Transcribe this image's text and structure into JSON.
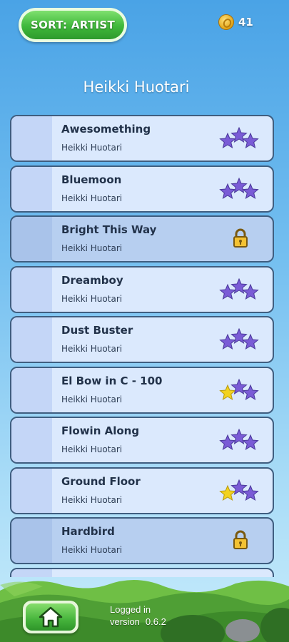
{
  "header": {
    "sort_label": "SORT: ARTIST",
    "coin_count": "41",
    "coin_icon": "coin-icon"
  },
  "page_title": "Heikki Huotari",
  "songs": [
    {
      "title": "Awesomething",
      "artist": "Heikki Huotari",
      "state": "stars",
      "gold_stars": 0,
      "purple_stars": 3
    },
    {
      "title": "Bluemoon",
      "artist": "Heikki Huotari",
      "state": "stars",
      "gold_stars": 0,
      "purple_stars": 3
    },
    {
      "title": "Bright This Way",
      "artist": "Heikki Huotari",
      "state": "locked"
    },
    {
      "title": "Dreamboy",
      "artist": "Heikki Huotari",
      "state": "stars",
      "gold_stars": 0,
      "purple_stars": 3
    },
    {
      "title": "Dust Buster",
      "artist": "Heikki Huotari",
      "state": "stars",
      "gold_stars": 0,
      "purple_stars": 3
    },
    {
      "title": "El Bow in C - 100",
      "artist": "Heikki Huotari",
      "state": "stars",
      "gold_stars": 1,
      "purple_stars": 2
    },
    {
      "title": "Flowin Along",
      "artist": "Heikki Huotari",
      "state": "stars",
      "gold_stars": 0,
      "purple_stars": 3
    },
    {
      "title": "Ground Floor",
      "artist": "Heikki Huotari",
      "state": "stars",
      "gold_stars": 1,
      "purple_stars": 2
    },
    {
      "title": "Hardbird",
      "artist": "Heikki Huotari",
      "state": "locked"
    }
  ],
  "footer": {
    "home_icon": "home-icon",
    "logged_in_text": "Logged in",
    "version_label": "version",
    "version_number": "0.6.2"
  },
  "colors": {
    "star_purple": "#7a5bd6",
    "star_gold": "#f2d21e",
    "button_green": "#3fb83a",
    "row_bg": "#dbe9fd",
    "row_locked_bg": "#b7cff0",
    "row_border": "#3f5e80"
  }
}
